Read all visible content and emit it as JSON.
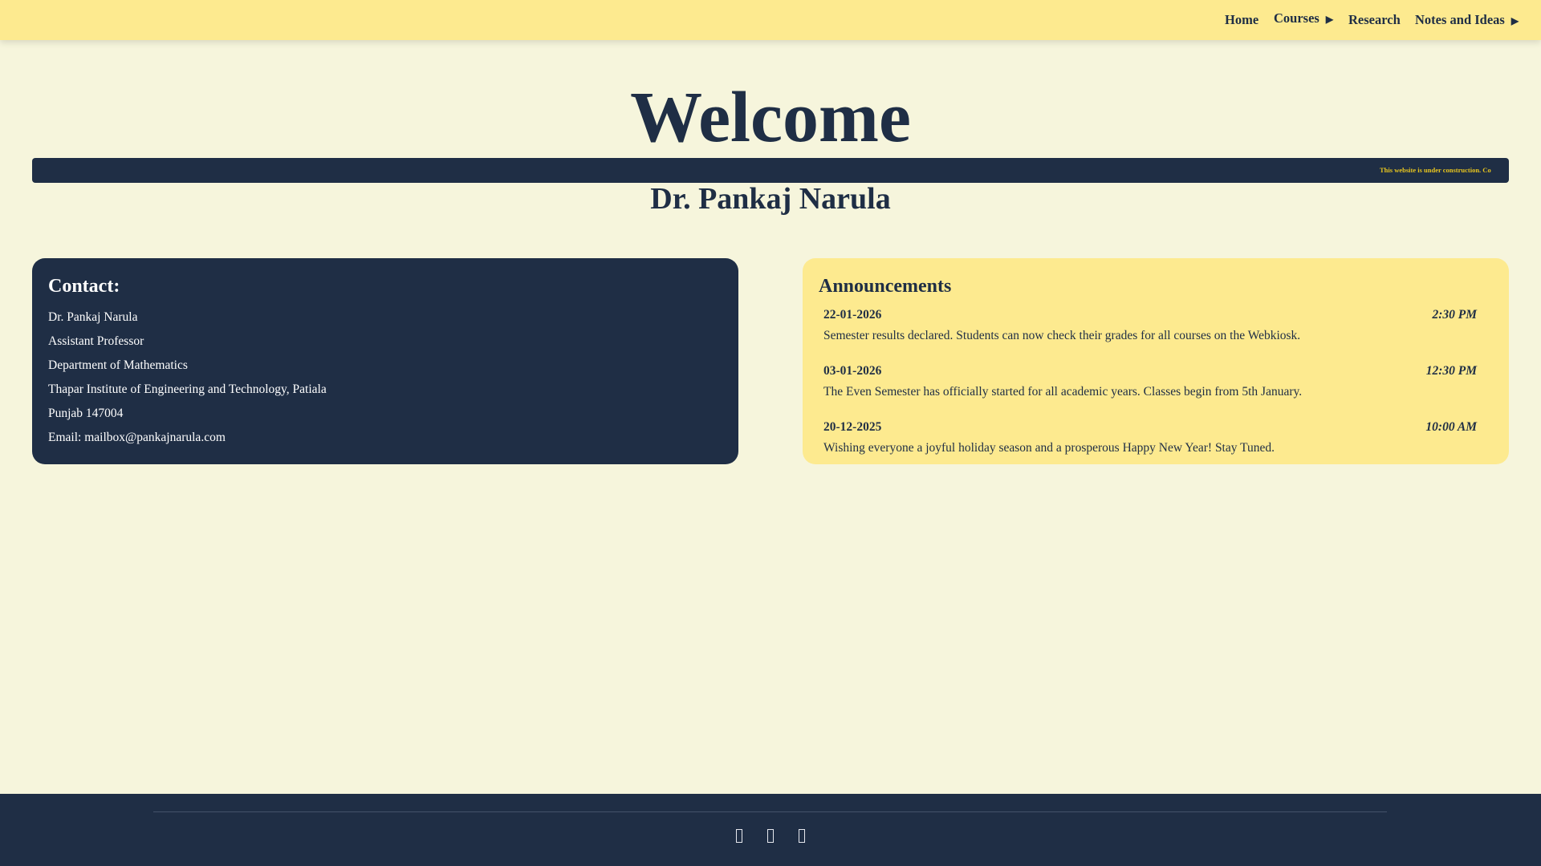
{
  "nav": {
    "items": [
      {
        "label": "Home"
      },
      {
        "label": "Courses",
        "submenu_icon": "▶"
      },
      {
        "label": "Research"
      },
      {
        "label": "Notes and Ideas",
        "submenu_icon": "▶"
      }
    ]
  },
  "hero": {
    "title": "Welcome",
    "ticker": "This website is under construction. Co",
    "name": "Dr. Pankaj Narula"
  },
  "contact": {
    "heading": "Contact:",
    "lines": [
      "Dr. Pankaj Narula",
      "Assistant Professor",
      "Department of Mathematics",
      "Thapar Institute of Engineering and Technology, Patiala",
      "Punjab 147004",
      "Email: mailbox@pankajnarula.com"
    ]
  },
  "announcements": {
    "heading": "Announcements",
    "items": [
      {
        "date": "22-01-2026",
        "time": "2:30 PM",
        "text": "Semester results declared. Students can now check their grades for all courses on the Webkiosk."
      },
      {
        "date": "03-01-2026",
        "time": "12:30 PM",
        "text": "The Even Semester has officially started for all academic years. Classes begin from 5th January."
      },
      {
        "date": "20-12-2025",
        "time": "10:00 AM",
        "text": "Wishing everyone a joyful holiday season and a prosperous Happy New Year! Stay Tuned."
      }
    ]
  },
  "footer": {
    "icons": [
      "social-icon-1",
      "social-icon-2",
      "social-icon-3"
    ]
  }
}
